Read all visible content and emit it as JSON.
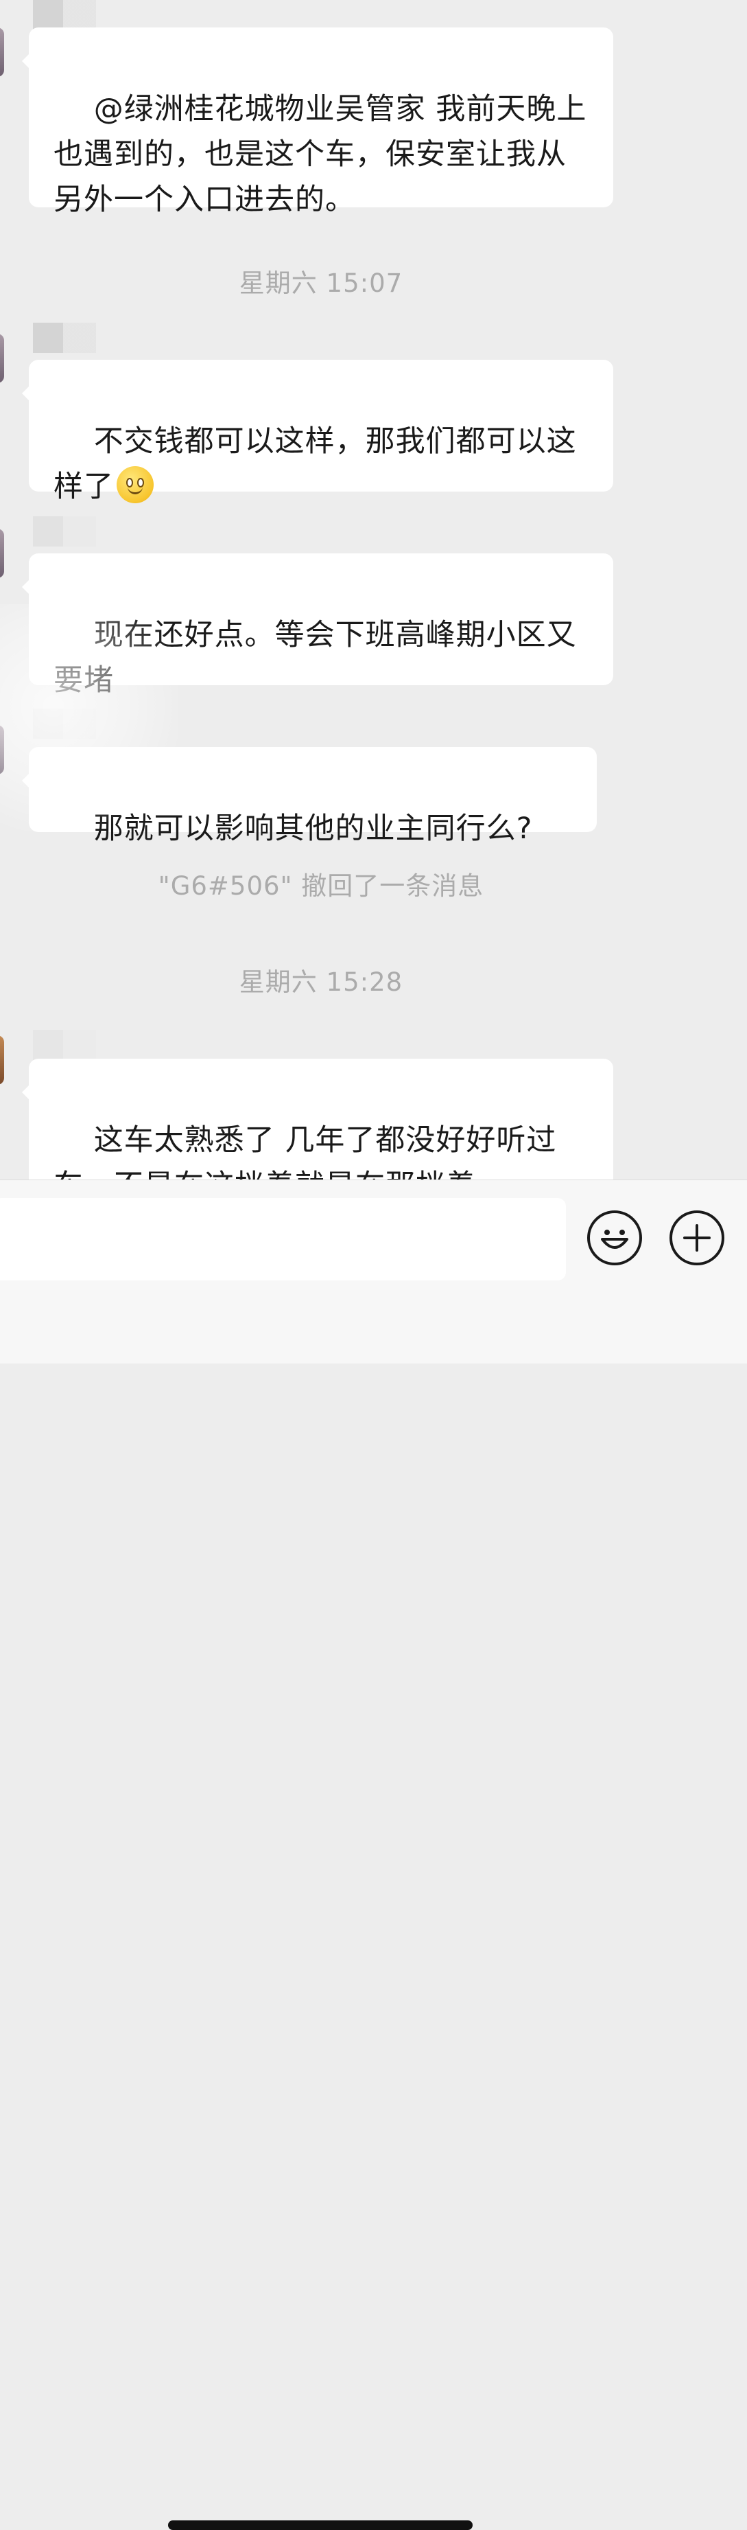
{
  "messages": [
    {
      "text": "@绿洲桂花城物业吴管家 我前天晚上也遇到的，也是这个车，保安室让我从另外一个入口进去的。"
    },
    {
      "text": "不交钱都可以这样，那我们都可以这样了",
      "emoji": "smile-emoji"
    },
    {
      "text": "现在还好点。等会下班高峰期小区又要堵"
    },
    {
      "text": "那就可以影响其他的业主同行么?"
    },
    {
      "text": "这车太熟悉了 几年了都没好好听过车，不是在这档着就是在那档着"
    }
  ],
  "timestamps": [
    "星期六 15:07",
    "星期六 15:28"
  ],
  "system_message": "\"G6#506\" 撤回了一条消息",
  "input_bar": {
    "placeholder": "",
    "emoji_icon": "smiley-face-icon",
    "plus_icon": "plus-circle-icon"
  },
  "colors": {
    "background": "#ededed",
    "bubble": "#ffffff",
    "timestamp_text": "#ababab",
    "message_text": "#1a1a1a"
  }
}
